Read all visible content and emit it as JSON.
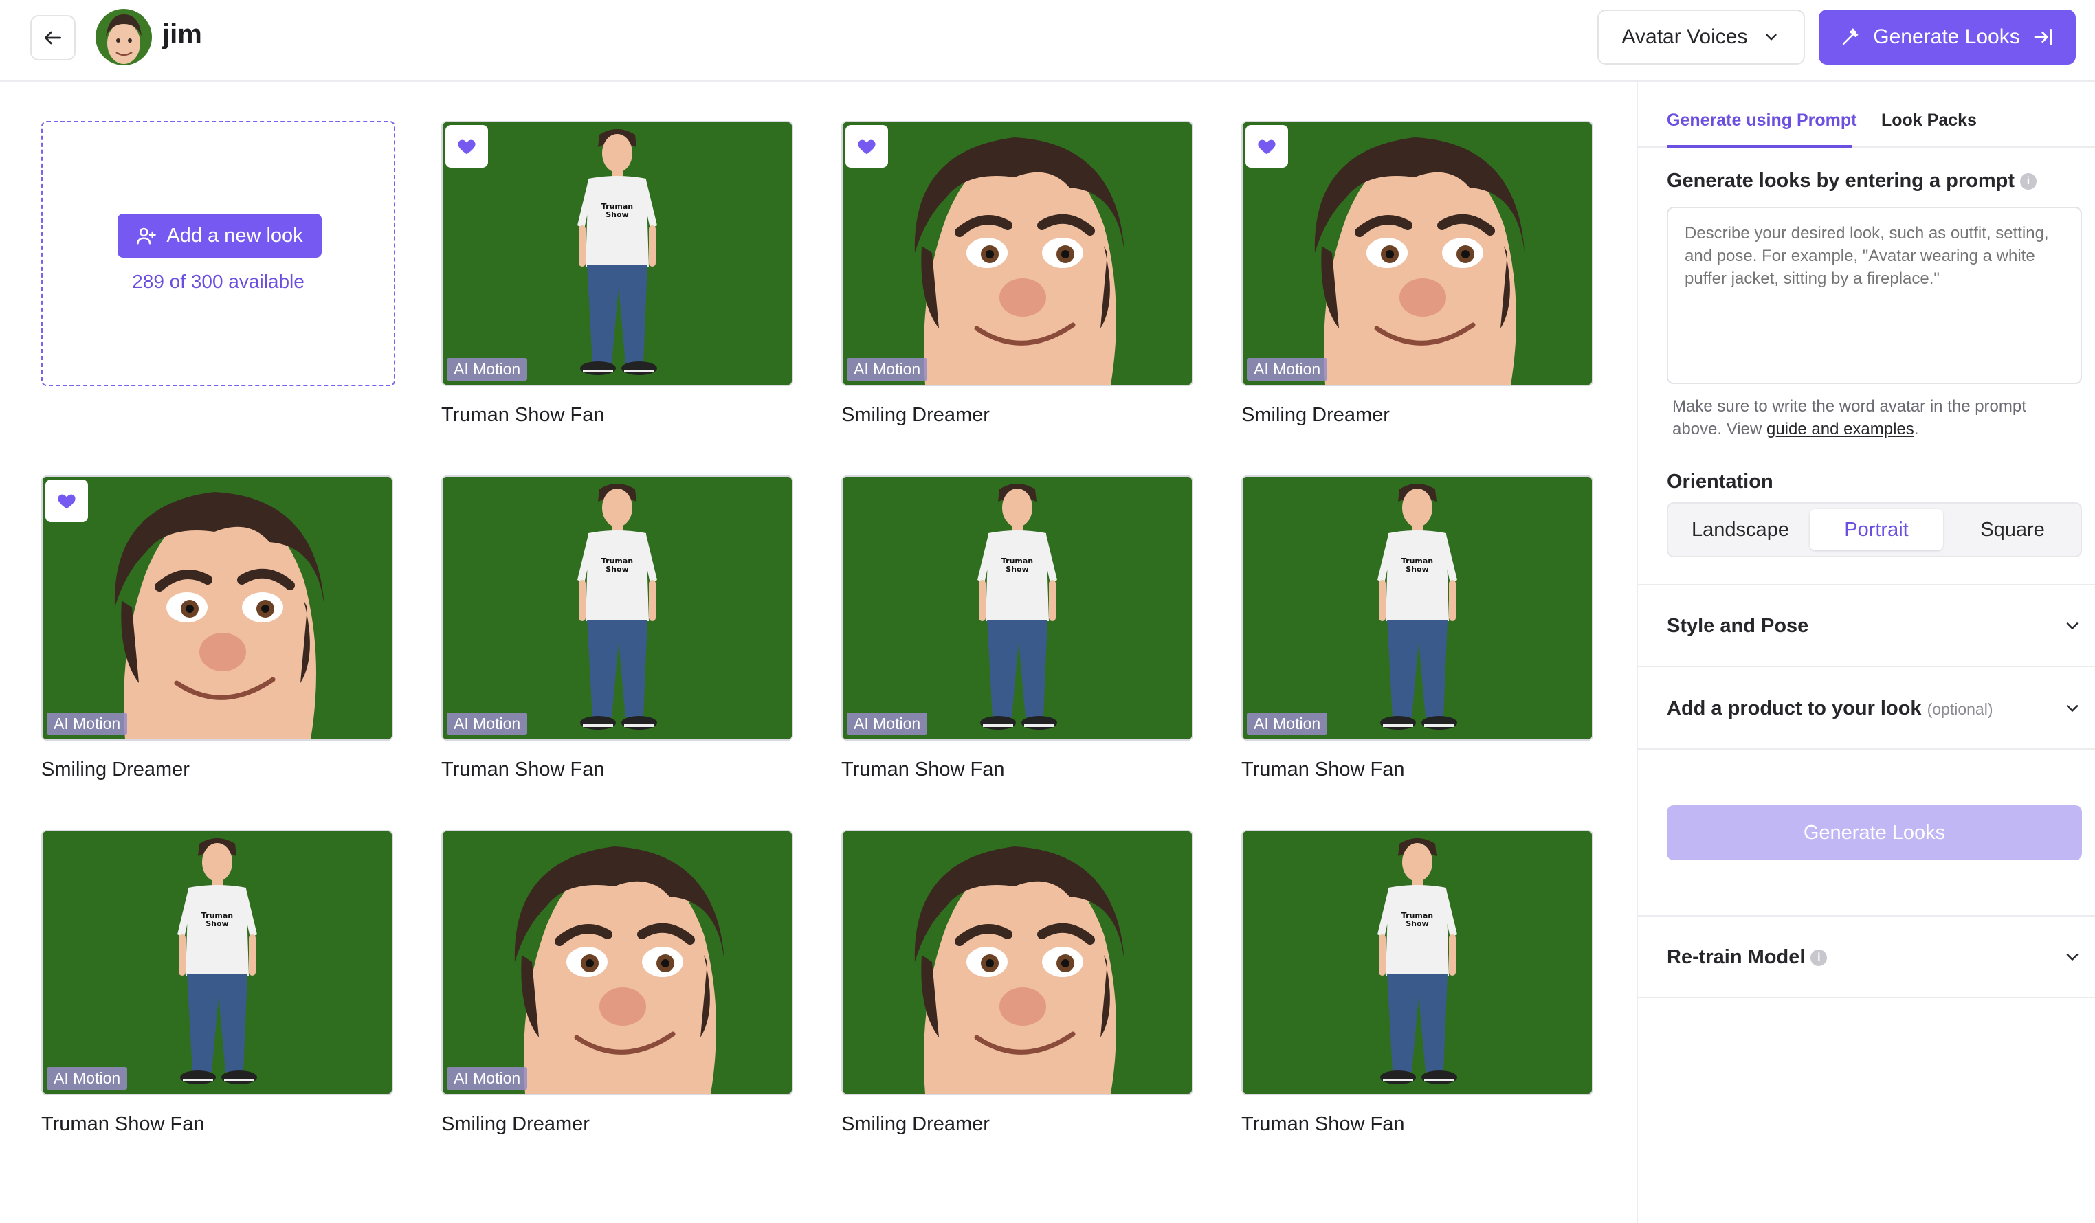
{
  "header": {
    "title": "jim",
    "voices_label": "Avatar Voices",
    "generate_label": "Generate Looks"
  },
  "add_card": {
    "button_label": "Add a new look",
    "available_text": "289 of 300 available"
  },
  "badge_text": "AI Motion",
  "looks": [
    {
      "name": "Truman Show Fan",
      "kind": "body",
      "favorite": true,
      "ai_motion": true
    },
    {
      "name": "Smiling Dreamer",
      "kind": "face",
      "favorite": true,
      "ai_motion": true
    },
    {
      "name": "Smiling Dreamer",
      "kind": "face",
      "favorite": true,
      "ai_motion": true
    },
    {
      "name": "Smiling Dreamer",
      "kind": "face",
      "favorite": true,
      "ai_motion": true
    },
    {
      "name": "Truman Show Fan",
      "kind": "body",
      "favorite": false,
      "ai_motion": true
    },
    {
      "name": "Truman Show Fan",
      "kind": "body",
      "favorite": false,
      "ai_motion": true
    },
    {
      "name": "Truman Show Fan",
      "kind": "body",
      "favorite": false,
      "ai_motion": true
    },
    {
      "name": "Truman Show Fan",
      "kind": "body",
      "favorite": false,
      "ai_motion": true
    },
    {
      "name": "Smiling Dreamer",
      "kind": "face",
      "favorite": false,
      "ai_motion": true
    },
    {
      "name": "Smiling Dreamer",
      "kind": "face",
      "favorite": false,
      "ai_motion": false
    },
    {
      "name": "Truman Show Fan",
      "kind": "body",
      "favorite": false,
      "ai_motion": false
    }
  ],
  "panel": {
    "tabs": [
      {
        "label": "Generate using Prompt",
        "active": true
      },
      {
        "label": "Look Packs",
        "active": false
      }
    ],
    "prompt_label": "Generate looks by entering a prompt",
    "prompt_placeholder": "Describe your desired look, such as outfit, setting, and pose. For example, \"Avatar wearing a white puffer jacket, sitting by a fireplace.\"",
    "hint_text": "Make sure to write the word avatar in the prompt above. View ",
    "hint_link": "guide and examples",
    "hint_end": ".",
    "orientation_label": "Orientation",
    "orientation_options": [
      "Landscape",
      "Portrait",
      "Square"
    ],
    "orientation_selected": "Portrait",
    "style_pose_label": "Style and Pose",
    "product_label": "Add a product to your look",
    "product_optional": "(optional)",
    "generate_label": "Generate Looks",
    "retrain_label": "Re-train Model"
  },
  "colors": {
    "accent": "#7559f0",
    "accent_disabled": "#c2b7f5",
    "green_screen": "#2f6e1e"
  },
  "icons": {
    "back": "arrow-left-icon",
    "chevron": "chevron-down-icon",
    "wand": "magic-wand-icon",
    "export": "arrow-right-to-bracket-icon",
    "add_user": "user-plus-icon",
    "heart": "heart-icon",
    "info": "info-icon"
  }
}
